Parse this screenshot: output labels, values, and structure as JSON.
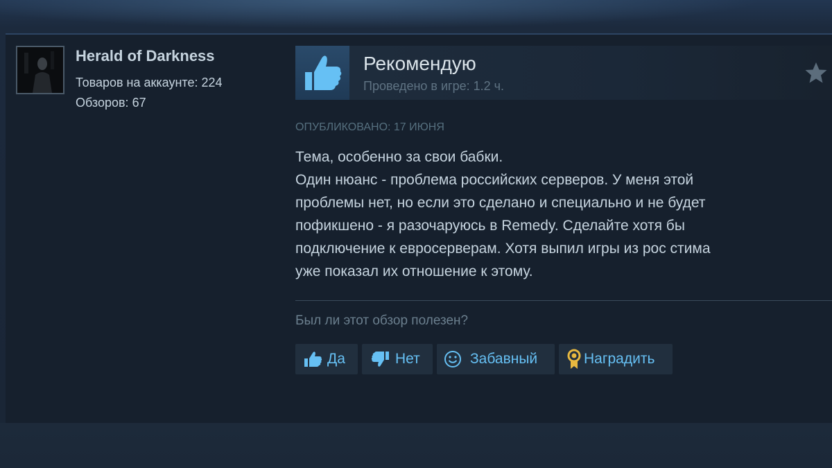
{
  "author": {
    "name": "Herald of Darkness",
    "products_text": "Товаров на аккаунте: 224",
    "reviews_text": "Обзоров: 67"
  },
  "review": {
    "verdict": "Рекомендую",
    "hours_text": "Проведено в игре: 1.2 ч.",
    "posted_text": "Опубликовано: 17 июня",
    "lines": [
      "Тема, особенно за свои бабки.",
      "Один нюанс - проблема российских серверов. У меня этой",
      "проблемы нет, но если это сделано и специально и не будет",
      "пофикшено - я разочаруюсь в Remedy. Сделайте хотя бы",
      "подключение к евросерверам. Хотя выпил игры из рос стима",
      "уже показал их отношение к этому."
    ]
  },
  "helpful": {
    "question": "Был ли этот обзор полезен?",
    "yes_label": "Да",
    "no_label": "Нет",
    "funny_label": "Забавный",
    "award_label": "Наградить"
  },
  "icons": {
    "verdict": "thumbs-up-icon",
    "award_star": "star-icon",
    "yes": "thumbs-up-icon",
    "no": "thumbs-down-icon",
    "funny": "smiley-icon",
    "award": "award-medal-icon"
  },
  "colors": {
    "background": "#1b2838",
    "panel": "#16202d",
    "text": "#c6d4df",
    "link": "#66c0f4",
    "thumb": "#66c0f4",
    "muted": "#56707f",
    "award_gold": "#e8b940"
  }
}
